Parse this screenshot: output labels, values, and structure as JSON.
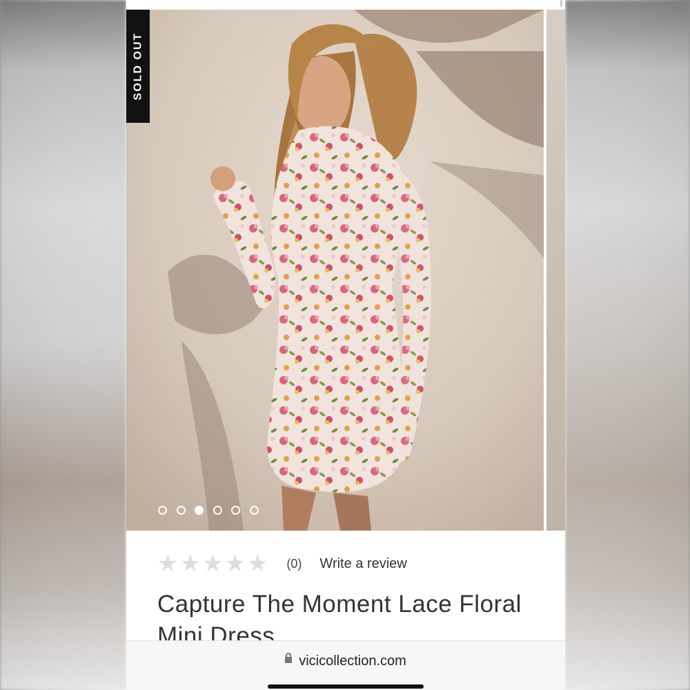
{
  "product": {
    "badge": "SOLD OUT",
    "rating_count": "(0)",
    "write_review": "Write a review",
    "title": "Capture The Moment Lace Floral Mini Dress",
    "star_rating": 0,
    "max_stars": 5
  },
  "gallery": {
    "total_images": 6,
    "active_index": 2
  },
  "browser": {
    "domain": "vicicollection.com"
  },
  "colors": {
    "badge_bg": "#111111",
    "star_empty": "#dedede",
    "text": "#333333"
  },
  "icons": [
    "lock-icon",
    "star-icon",
    "home-indicator"
  ]
}
